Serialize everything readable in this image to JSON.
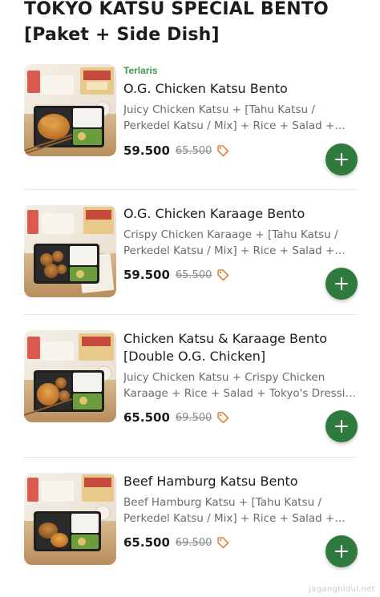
{
  "section": {
    "title_line1": "TOKYO KATSU SPECIAL BENTO",
    "title_line2": "[Paket + Side Dish]"
  },
  "items": [
    {
      "badge": "Terlaris",
      "name": "O.G. Chicken Katsu Bento",
      "description": "Juicy Chicken Katsu + [Tahu Katsu / Perkedel Katsu / Mix] + Rice + Salad + Tokyo's Dressing",
      "price": "59.500",
      "old_price": "65.500"
    },
    {
      "badge": "",
      "name": "O.G. Chicken Karaage Bento",
      "description": "Crispy Chicken Karaage + [Tahu Katsu / Perkedel Katsu / Mix] + Rice + Salad + Tokyo's Dressing",
      "price": "59.500",
      "old_price": "65.500"
    },
    {
      "badge": "",
      "name": "Chicken Katsu & Karaage Bento [Double O.G. Chicken]",
      "description": "Juicy Chicken Katsu + Crispy Chicken Karaage + Rice + Salad + Tokyo's Dressing + ...",
      "price": "65.500",
      "old_price": "69.500"
    },
    {
      "badge": "",
      "name": "Beef Hamburg Katsu Bento",
      "description": "Beef Hamburg Katsu + [Tahu Katsu / Perkedel Katsu / Mix] + Rice + Salad + Tokyo's Dressing",
      "price": "65.500",
      "old_price": "69.500"
    }
  ],
  "watermark": "jaganghidul.net",
  "colors": {
    "badge_green": "#3a9a4e",
    "add_button_green": "#2f7a3d",
    "promo_tag_orange": "#e8833a"
  },
  "icons": {
    "add": "plus-icon",
    "promo": "tag-icon"
  }
}
